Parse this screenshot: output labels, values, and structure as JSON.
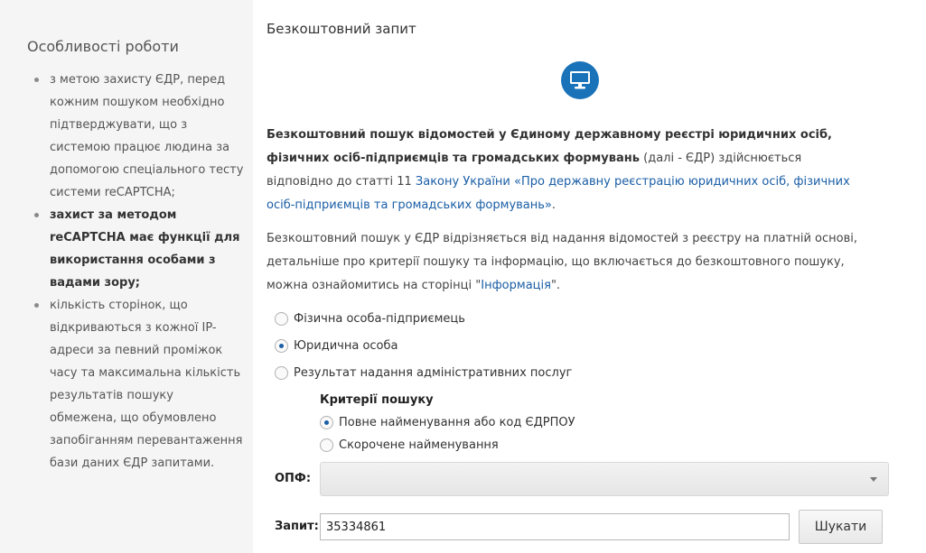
{
  "sidebar": {
    "title": "Особливості роботи",
    "items": [
      {
        "text": "з метою захисту ЄДР, перед кожним пошуком необхідно підтверджувати, що з системою працює людина за допомогою спеціального тесту системи reCAPTCHA;",
        "bold": false
      },
      {
        "text": "захист за методом reCAPTCHA має функції для використання особами з вадами зору;",
        "bold": true
      },
      {
        "text": "кількість сторінок, що відкриваються з кожної IP-адреси за певний проміжок часу та максимальна кількість результатів пошуку обмежена, що обумовлено запобіганням перевантаження бази даних ЄДР запитами.",
        "bold": false
      }
    ]
  },
  "main": {
    "title": "Безкоштовний запит",
    "icon": "monitor-icon",
    "accent_color": "#1a73b9",
    "para1": {
      "bold": "Безкоштовний пошук відомостей у Єдиному державному реєстрі юридичних осіб, фізичних осіб-підприємців та громадських формувань",
      "text": " (далі - ЄДР) здійснюється відповідно до статті 11 ",
      "link": "Закону України «Про державну реєстрацію юридичних осіб, фізичних осіб-підприємців та громадських формувань»",
      "end": "."
    },
    "para2": {
      "text": "Безкоштовний пошук у ЄДР відрізняється від надання відомостей з реєстру на платній основі, детальніше про критерії пошуку та інформацію, що включається до безкоштовного пошуку, можна ознайомитись на сторінці \"",
      "link": "Інформація",
      "end": "\"."
    }
  },
  "search_type": {
    "options": [
      {
        "label": "Фізична особа-підприємець",
        "checked": false
      },
      {
        "label": "Юридична особа",
        "checked": true
      },
      {
        "label": "Результат надання адміністративних послуг",
        "checked": false
      }
    ]
  },
  "criteria": {
    "title": "Критерії пошуку",
    "options": [
      {
        "label": "Повне найменування або код ЄДРПОУ",
        "checked": true
      },
      {
        "label": "Скорочене найменування",
        "checked": false
      }
    ]
  },
  "form": {
    "opf_label": "ОПФ:",
    "opf_value": "",
    "query_label": "Запит:",
    "query_value": "35334861",
    "search_button": "Шукати"
  }
}
